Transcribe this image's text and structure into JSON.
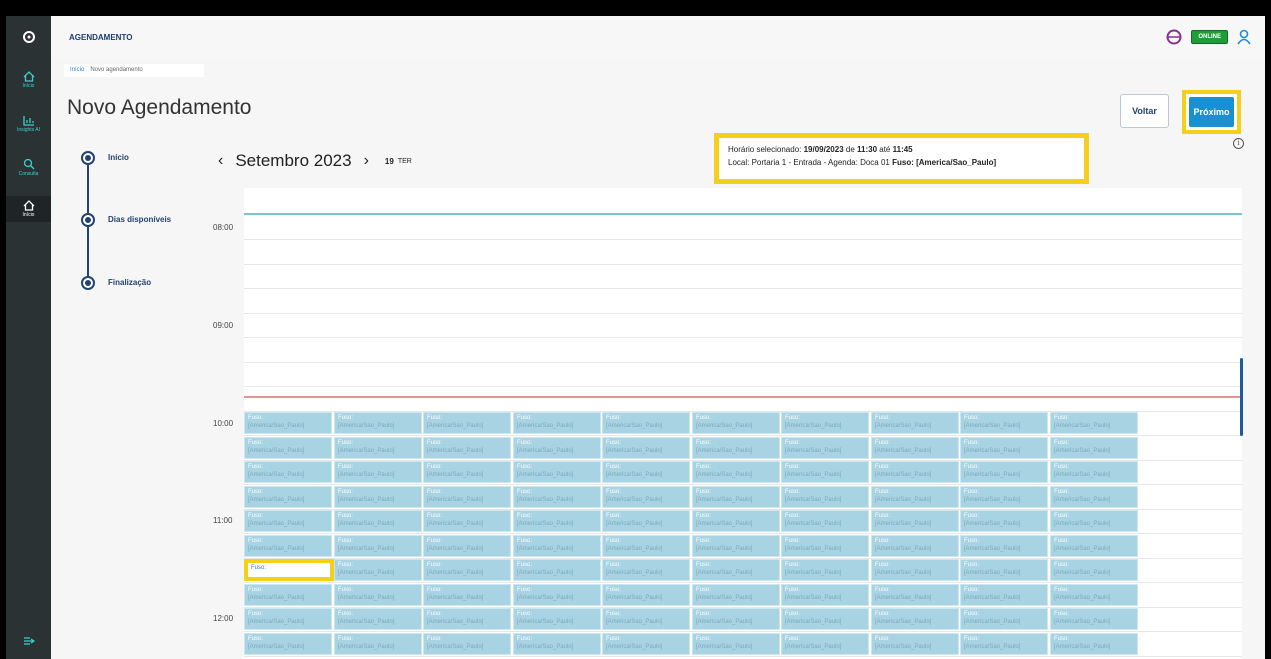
{
  "app": {
    "title": "AGENDAMENTO",
    "online_badge": "ONLINE"
  },
  "sidebar": {
    "items": [
      {
        "icon": "home-icon",
        "label": "Início"
      },
      {
        "icon": "chart-icon",
        "label": "Insights AI"
      },
      {
        "icon": "search-icon",
        "label": "Consulta"
      },
      {
        "icon": "home-icon",
        "label": "Início"
      }
    ]
  },
  "breadcrumb": {
    "items": [
      "Início",
      "Novo agendamento"
    ]
  },
  "page": {
    "title": "Novo Agendamento"
  },
  "actions": {
    "back_label": "Voltar",
    "next_label": "Próximo"
  },
  "steps": [
    {
      "label": "Início"
    },
    {
      "label": "Dias disponíveis"
    },
    {
      "label": "Finalização"
    }
  ],
  "calendar": {
    "month_label": "Setembro 2023",
    "day_number": "19",
    "day_name": "TER",
    "hours": [
      "08:00",
      "09:00",
      "10:00",
      "11:00",
      "12:00"
    ],
    "slot_title": "Fuso:",
    "slot_subtitle": "[America/Sao_Paulo]",
    "columns": 10,
    "rows": 10,
    "selected": {
      "row": 6,
      "col": 0
    }
  },
  "selection": {
    "line1_prefix": "Horário selecionado: ",
    "date": "19/09/2023",
    "de": " de ",
    "start": "11:30",
    "ate": " até ",
    "end": "11:45",
    "line2_prefix": "Local: Portaria 1 - Entrada - Agenda: Doca 01 ",
    "fuso_label": "Fuso: [America/Sao_Paulo]"
  },
  "colors": {
    "accent": "#1a8fd1",
    "highlight": "#f4cf1b",
    "slot": "#a8d3e2",
    "online": "#1e9e38"
  }
}
